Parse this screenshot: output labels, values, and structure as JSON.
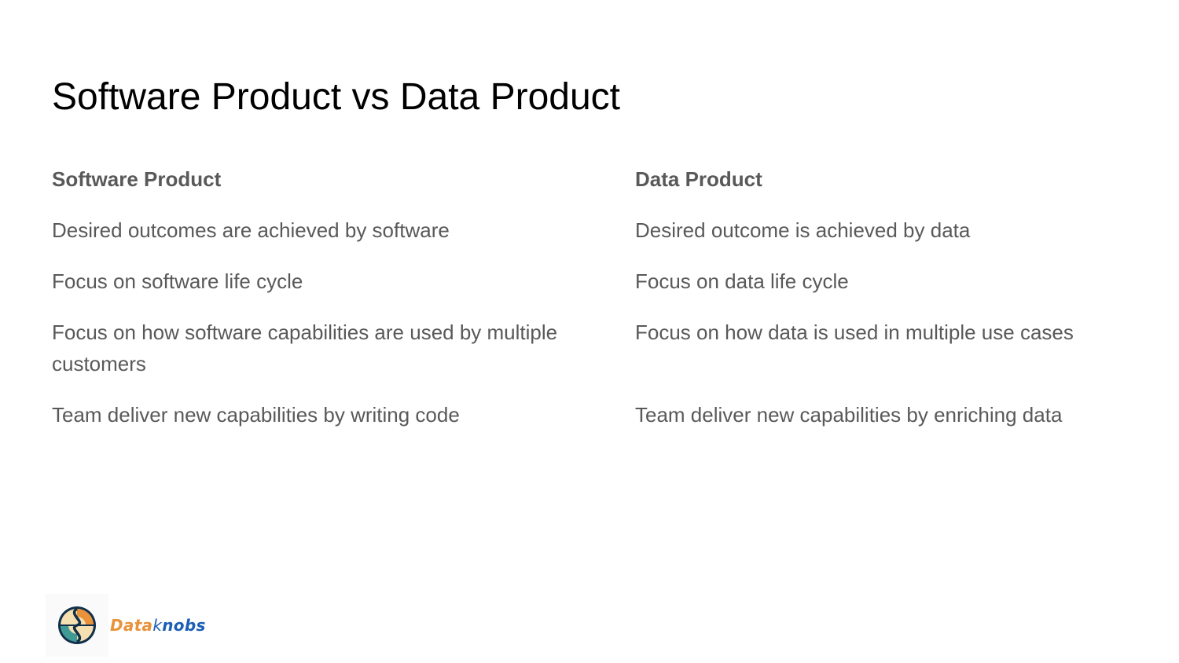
{
  "slide": {
    "title": "Software Product vs Data Product"
  },
  "left_column": {
    "heading": "Software Product",
    "items": [
      "Desired outcomes are achieved by software",
      "Focus on software life cycle",
      "Focus on how software capabilities are used by multiple customers",
      "Team deliver new capabilities by writing code"
    ]
  },
  "right_column": {
    "heading": "Data Product",
    "items": [
      "Desired outcome is achieved by data",
      "Focus on data life cycle",
      "Focus on how data is used in multiple use cases",
      "Team deliver new capabilities by enriching data"
    ]
  },
  "logo": {
    "name": "Dataknobs",
    "part1": "Data",
    "part2": "k",
    "part3": "nobs",
    "icon": "dataknobs-logo-icon",
    "colors": {
      "orange": "#e8923a",
      "blue": "#1a5fb4",
      "teal": "#3f9a96",
      "cream": "#f6dfb0",
      "navy": "#0f2f4a"
    }
  }
}
